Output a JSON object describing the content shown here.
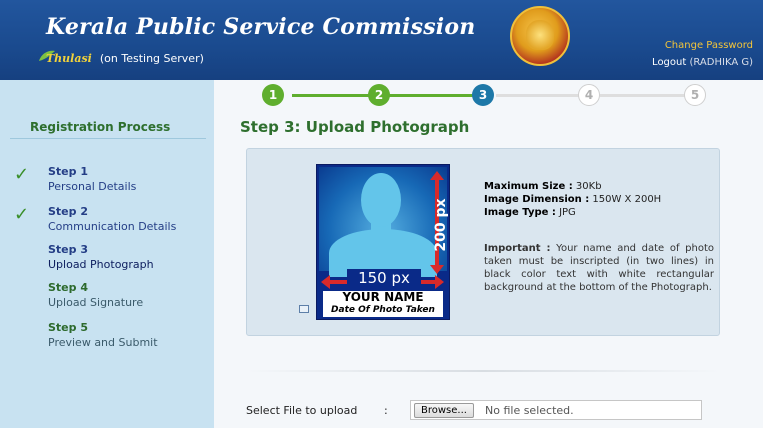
{
  "header": {
    "title": "Kerala Public Service Commission",
    "brand": "Thulasi",
    "server_note": "(on Testing Server)",
    "change_password": "Change Password",
    "logout": "Logout",
    "user": "(RADHIKA G)"
  },
  "sidebar": {
    "title": "Registration Process",
    "steps": [
      {
        "label": "Step 1",
        "desc": "Personal Details",
        "state": "done"
      },
      {
        "label": "Step 2",
        "desc": "Communication Details",
        "state": "done"
      },
      {
        "label": "Step 3",
        "desc": "Upload Photograph",
        "state": "active"
      },
      {
        "label": "Step 4",
        "desc": "Upload Signature",
        "state": "pending"
      },
      {
        "label": "Step 5",
        "desc": "Preview and Submit",
        "state": "pending"
      }
    ]
  },
  "progress": {
    "steps": [
      "1",
      "2",
      "3",
      "4",
      "5"
    ],
    "current": 3
  },
  "main": {
    "heading": "Step 3: Upload Photograph",
    "sample": {
      "height_label": "200 px",
      "width_label": "150 px",
      "name_line": "YOUR NAME",
      "date_line": "Date Of Photo Taken"
    },
    "info": {
      "max_size_label": "Maximum Size :",
      "max_size_value": "30Kb",
      "dimension_label": "Image Dimension :",
      "dimension_value": "150W X 200H",
      "type_label": "Image Type :",
      "type_value": "JPG",
      "important_label": "Important :",
      "important_text": "Your name and date of photo taken must be inscripted (in two lines) in black color text with white rectangular background at the bottom of the Photograph."
    },
    "file": {
      "label": "Select File to upload",
      "colon": ":",
      "browse": "Browse...",
      "status": "No file selected."
    }
  },
  "colors": {
    "header_bg": "#1a4a8e",
    "sidebar_bg": "#c8e2f1",
    "heading_green": "#2e6f2e",
    "step_done": "#5fae2e",
    "step_active": "#1d78a8"
  }
}
